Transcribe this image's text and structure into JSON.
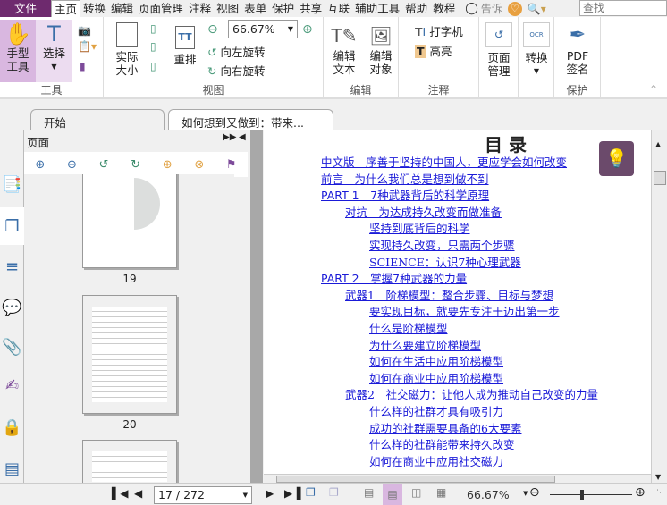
{
  "menu": {
    "file": "文件",
    "items": [
      "主页",
      "转换",
      "编辑",
      "页面管理",
      "注释",
      "视图",
      "表单",
      "保护",
      "共享",
      "互联",
      "辅助工具",
      "帮助",
      "教程"
    ],
    "tell": "告诉",
    "search_placeholder": "查找"
  },
  "ribbon": {
    "tools": {
      "hand": "手型\n工具",
      "select": "选择",
      "label": "工具"
    },
    "view": {
      "actual": "实际\n大小",
      "reflow": "重排",
      "zoom": "66.67%",
      "rotate_left": "向左旋转",
      "rotate_right": "向右旋转",
      "label": "视图"
    },
    "edit": {
      "edit_text": "编辑\n文本",
      "edit_object": "编辑\n对象",
      "label": "编辑"
    },
    "comment": {
      "typewriter": "打字机",
      "highlight": "高亮",
      "label": "注释"
    },
    "page": {
      "manage": "页面\n管理"
    },
    "convert": {
      "convert": "转换"
    },
    "protect": {
      "sign": "PDF\n签名",
      "label": "保护"
    }
  },
  "tabs": [
    {
      "label": "开始"
    },
    {
      "label": "如何想到又做到：带来..."
    }
  ],
  "panel": {
    "title": "页面",
    "thumbs": [
      {
        "page": "19"
      },
      {
        "page": "20"
      }
    ]
  },
  "doc": {
    "title": "目 录",
    "toc": [
      {
        "text": "中文版　序善于坚持的中国人，更应学会如何改变",
        "level": 0
      },
      {
        "text": "前言　为什么我们总是想到做不到",
        "level": 0
      },
      {
        "text": "PART 1　7种武器背后的科学原理",
        "level": 0
      },
      {
        "text": "对抗　为达成持久改变而做准备",
        "level": 1
      },
      {
        "text": "坚持到底背后的科学",
        "level": 2
      },
      {
        "text": "实现持久改变，只需两个步骤",
        "level": 2
      },
      {
        "text": "SCIENCE：认识7种心理武器",
        "level": 2
      },
      {
        "text": "PART 2　掌握7种武器的力量",
        "level": 0
      },
      {
        "text": "武器1　阶梯模型：整合步骤、目标与梦想",
        "level": 1
      },
      {
        "text": "要实现目标，就要先专注于迈出第一步",
        "level": 2
      },
      {
        "text": "什么是阶梯模型",
        "level": 2
      },
      {
        "text": "为什么要建立阶梯模型",
        "level": 2
      },
      {
        "text": "如何在生活中应用阶梯模型",
        "level": 2
      },
      {
        "text": "如何在商业中应用阶梯模型",
        "level": 2
      },
      {
        "text": "武器2　社交磁力：让他人成为推动自己改变的力量",
        "level": 1
      },
      {
        "text": "什么样的社群才具有吸引力",
        "level": 2
      },
      {
        "text": "成功的社群需要具备的6大要素",
        "level": 2
      },
      {
        "text": "什么样的社群能带来持久改变",
        "level": 2
      },
      {
        "text": "如何在商业中应用社交磁力",
        "level": 2
      }
    ]
  },
  "status": {
    "page": "17 / 272",
    "zoom": "66.67%",
    "zoom_fraction": 0.5
  },
  "colors": {
    "accent": "#6e2a6e",
    "link": "#1a1ad8",
    "bulb_bg": "#6b4a6b"
  }
}
